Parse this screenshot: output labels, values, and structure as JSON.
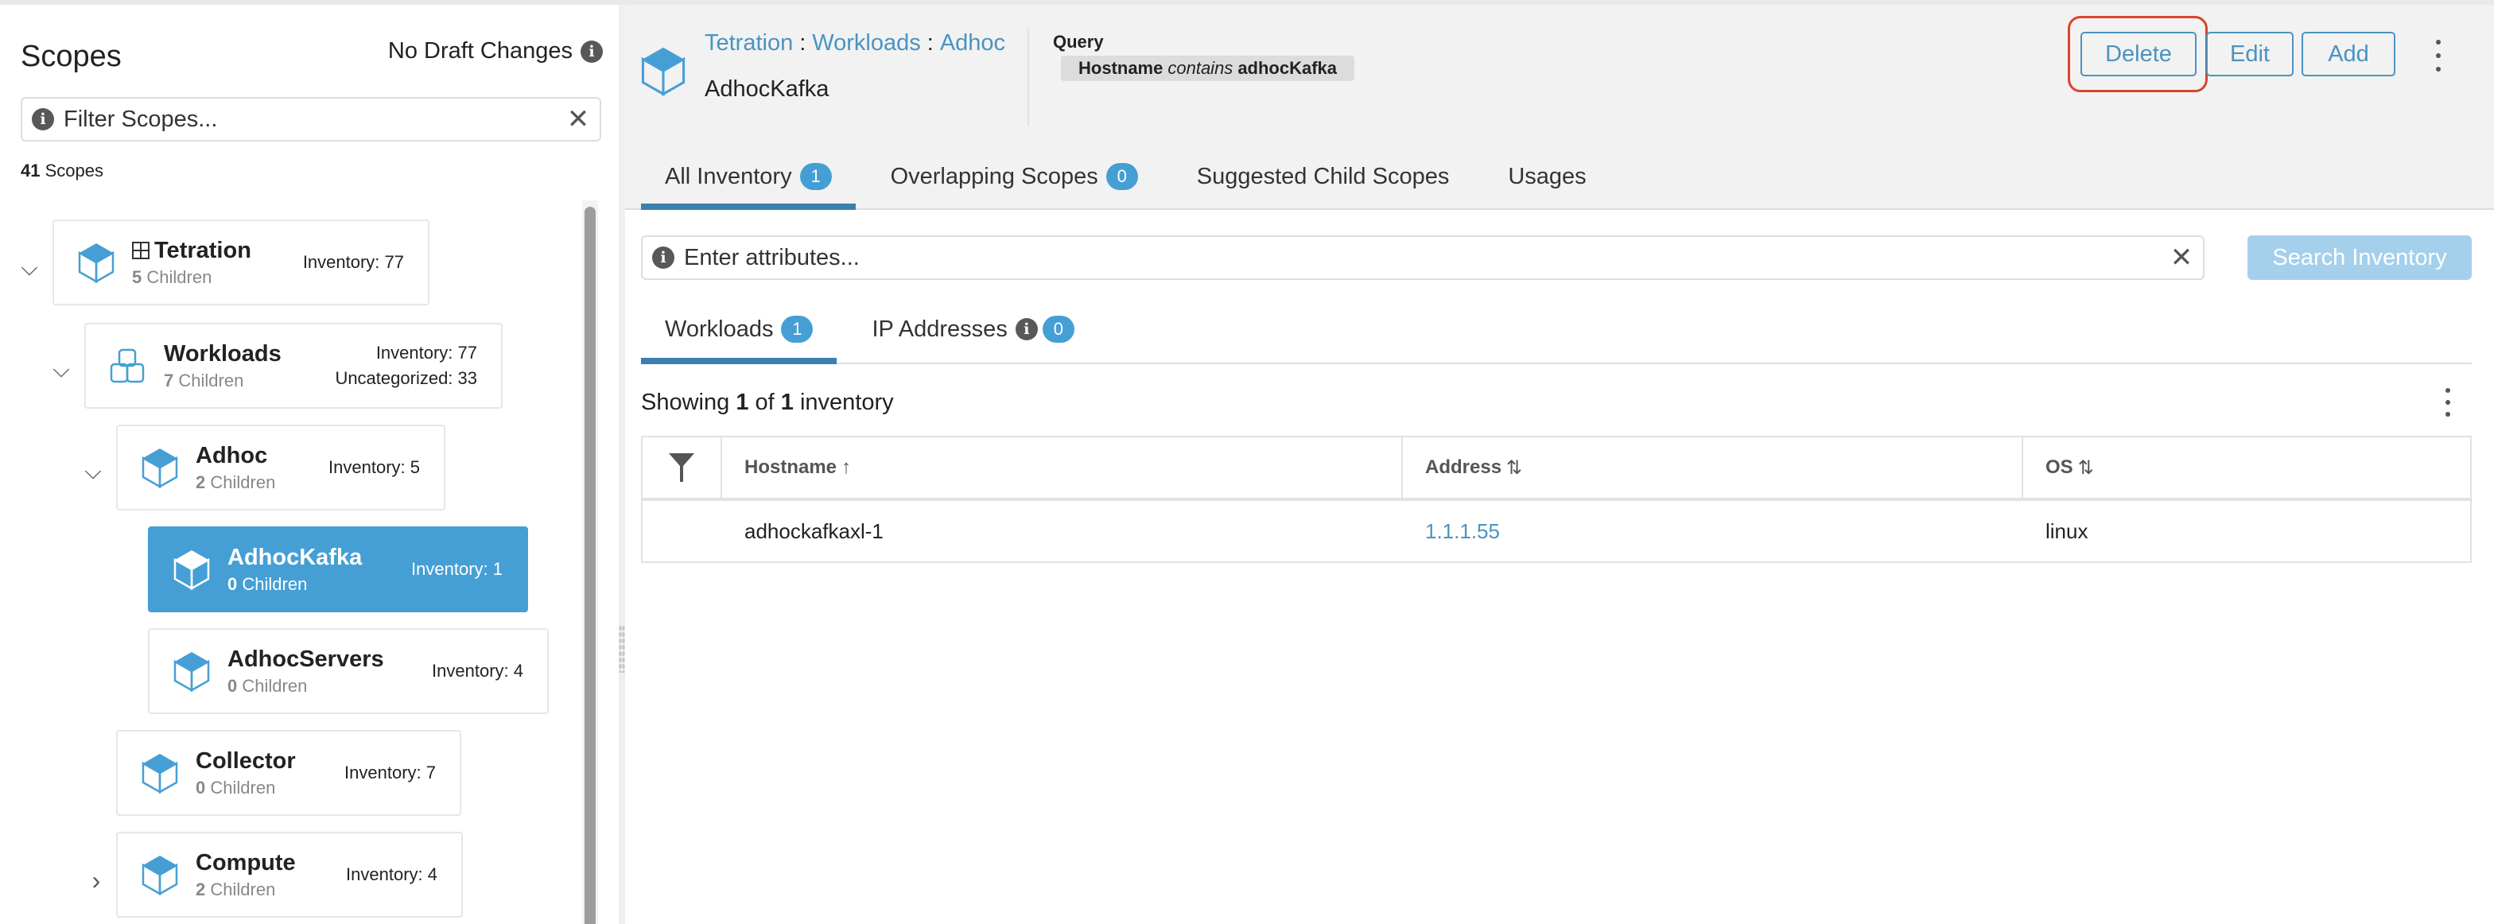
{
  "left_panel": {
    "title": "Scopes",
    "draft_status": "No Draft Changes",
    "filter": {
      "placeholder": "Filter Scopes...",
      "value": ""
    },
    "scope_count": {
      "number": "41",
      "label": "Scopes"
    },
    "tree": [
      {
        "name": "Tetration",
        "children_count": "5",
        "children_label": "Children",
        "inventory": "Inventory: 77",
        "expanded": true,
        "root": true,
        "icon": "cube-icon"
      },
      {
        "name": "Workloads",
        "children_count": "7",
        "children_label": "Children",
        "inventory": "Inventory: 77",
        "uncategorized": "Uncategorized: 33",
        "expanded": true,
        "icon": "workloads-icon"
      },
      {
        "name": "Adhoc",
        "children_count": "2",
        "children_label": "Children",
        "inventory": "Inventory: 5",
        "expanded": true,
        "icon": "cube-icon"
      },
      {
        "name": "AdhocKafka",
        "children_count": "0",
        "children_label": "Children",
        "inventory": "Inventory: 1",
        "selected": true,
        "icon": "cube-icon"
      },
      {
        "name": "AdhocServers",
        "children_count": "0",
        "children_label": "Children",
        "inventory": "Inventory: 4",
        "icon": "cube-icon"
      },
      {
        "name": "Collector",
        "children_count": "0",
        "children_label": "Children",
        "inventory": "Inventory: 7",
        "icon": "cube-icon"
      },
      {
        "name": "Compute",
        "children_count": "2",
        "children_label": "Children",
        "inventory": "Inventory: 4",
        "expanded": false,
        "icon": "cube-icon"
      }
    ]
  },
  "header": {
    "breadcrumb": [
      "Tetration",
      "Workloads",
      "Adhoc"
    ],
    "breadcrumb_sep": ":",
    "scope_name": "AdhocKafka",
    "query_label": "Query",
    "query": {
      "field": "Hostname",
      "operator": "contains",
      "value": "adhocKafka"
    },
    "actions": {
      "delete": "Delete",
      "edit": "Edit",
      "add": "Add"
    },
    "tabs": [
      {
        "label": "All Inventory",
        "badge": "1",
        "active": true
      },
      {
        "label": "Overlapping Scopes",
        "badge": "0"
      },
      {
        "label": "Suggested Child Scopes"
      },
      {
        "label": "Usages"
      }
    ]
  },
  "search": {
    "placeholder": "Enter attributes...",
    "value": "",
    "button": "Search Inventory"
  },
  "subtabs": [
    {
      "label": "Workloads",
      "badge": "1",
      "active": true
    },
    {
      "label": "IP Addresses",
      "badge": "0",
      "info": true
    }
  ],
  "results": {
    "prefix": "Showing",
    "shown": "1",
    "of": "of",
    "total": "1",
    "suffix": "inventory"
  },
  "table": {
    "columns": [
      {
        "label": "Hostname",
        "sort": "↑"
      },
      {
        "label": "Address",
        "sort": "⇅"
      },
      {
        "label": "OS",
        "sort": "⇅"
      }
    ],
    "rows": [
      {
        "hostname": "adhockafkaxl-1",
        "address": "1.1.1.55",
        "os": "linux"
      }
    ]
  },
  "colors": {
    "accent": "#459fd5",
    "link": "#4a93c1",
    "tab_underline": "#3a81b0",
    "highlight_ring": "#d9452c",
    "search_disabled": "#a4d0ec"
  }
}
